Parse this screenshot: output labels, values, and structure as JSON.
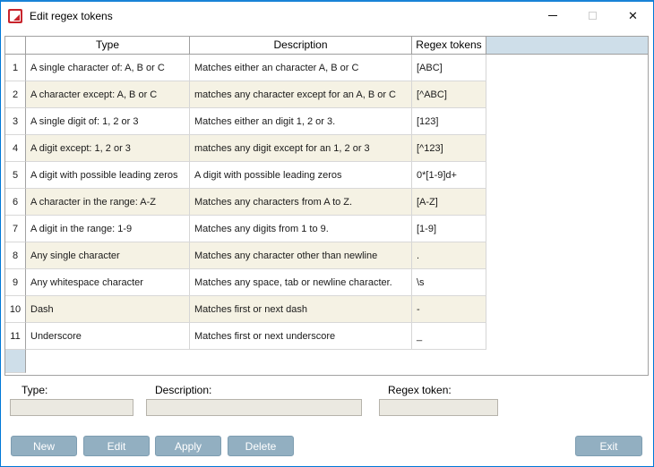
{
  "window": {
    "title": "Edit regex tokens",
    "accent_color": "#0078d7",
    "icon_color": "#c8242c",
    "controls": {
      "close_glyph": "✕"
    }
  },
  "table": {
    "headers": [
      "Type",
      "Description",
      "Regex tokens"
    ],
    "rows": [
      {
        "num": "1",
        "type": "A single character of: A, B or C",
        "description": "Matches either an character A, B or C",
        "token": "[ABC]"
      },
      {
        "num": "2",
        "type": "A character except: A, B or C",
        "description": "matches any character except for an A, B or C",
        "token": "[^ABC]"
      },
      {
        "num": "3",
        "type": "A single digit of: 1, 2 or 3",
        "description": "Matches either an digit 1, 2 or 3.",
        "token": "[123]"
      },
      {
        "num": "4",
        "type": "A digit except: 1, 2 or 3",
        "description": "matches any digit except for an 1, 2 or 3",
        "token": "[^123]"
      },
      {
        "num": "5",
        "type": "A digit with possible leading zeros",
        "description": "A digit with possible leading zeros",
        "token": "0*[1-9]d+"
      },
      {
        "num": "6",
        "type": "A character in the range: A-Z",
        "description": "Matches any characters from A to Z.",
        "token": "[A-Z]"
      },
      {
        "num": "7",
        "type": "A digit in the range: 1-9",
        "description": "Matches any digits from 1 to 9.",
        "token": "[1-9]"
      },
      {
        "num": "8",
        "type": "Any single character",
        "description": "Matches any character other than newline",
        "token": "."
      },
      {
        "num": "9",
        "type": "Any whitespace character",
        "description": "Matches any space, tab or newline character.",
        "token": "\\s"
      },
      {
        "num": "10",
        "type": "Dash",
        "description": "Matches first or next dash",
        "token": "-"
      },
      {
        "num": "11",
        "type": "Underscore",
        "description": "Matches first or next underscore",
        "token": "_"
      }
    ],
    "stripe_color": "#f5f2e4",
    "header_filler_color": "#cedee9"
  },
  "form": {
    "type_label": "Type:",
    "description_label": "Description:",
    "regex_label": "Regex token:",
    "type_value": "",
    "description_value": "",
    "regex_value": ""
  },
  "buttons": {
    "new": "New",
    "edit": "Edit",
    "apply": "Apply",
    "delete": "Delete",
    "exit": "Exit",
    "color": "#92afc1"
  }
}
